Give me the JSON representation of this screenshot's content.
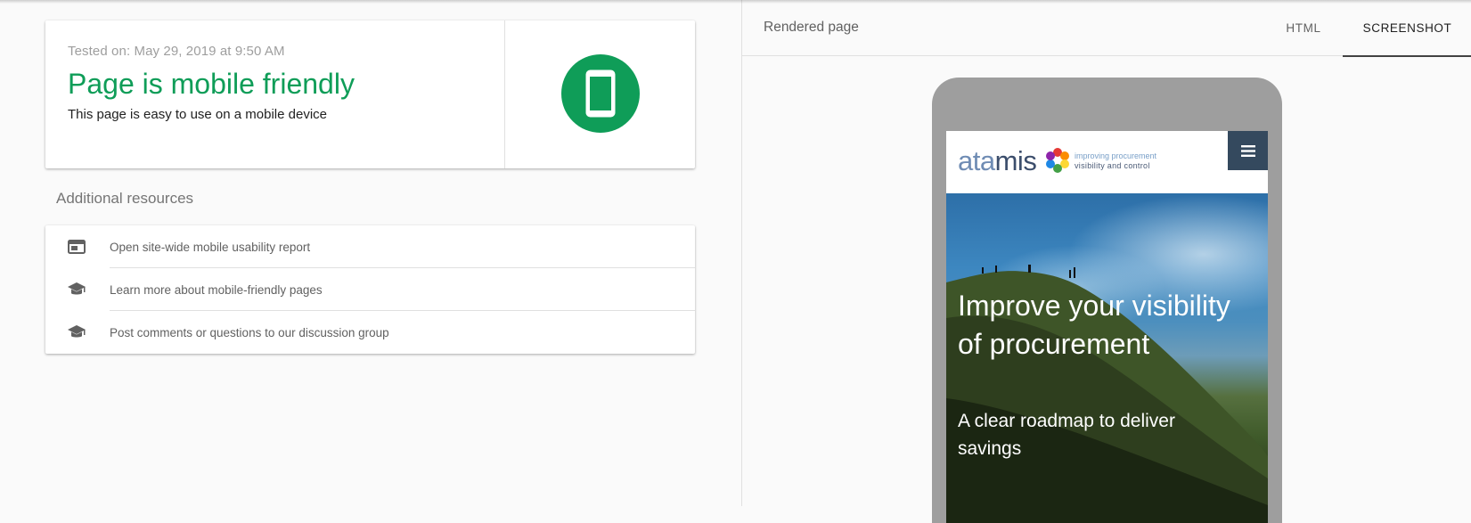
{
  "result": {
    "tested_on": "Tested on: May 29, 2019 at 9:50 AM",
    "verdict": "Page is mobile friendly",
    "verdict_sub": "This page is easy to use on a mobile device"
  },
  "resources": {
    "title": "Additional resources",
    "items": [
      {
        "label": "Open site-wide mobile usability report",
        "icon": "web-report-icon"
      },
      {
        "label": "Learn more about mobile-friendly pages",
        "icon": "school-icon"
      },
      {
        "label": "Post comments or questions to our discussion group",
        "icon": "school-icon"
      }
    ]
  },
  "preview": {
    "label": "Rendered page",
    "tabs": [
      {
        "label": "HTML",
        "active": false
      },
      {
        "label": "SCREENSHOT",
        "active": true
      }
    ]
  },
  "site": {
    "logo_a": "ata",
    "logo_b": "mis",
    "tagline_1": "improving procurement",
    "tagline_2": "visibility and control",
    "hero_title": "Improve your visibility of procurement",
    "hero_sub": "A clear roadmap to deliver savings"
  },
  "colors": {
    "success": "#0f9d58",
    "menu_button": "#34495e"
  }
}
